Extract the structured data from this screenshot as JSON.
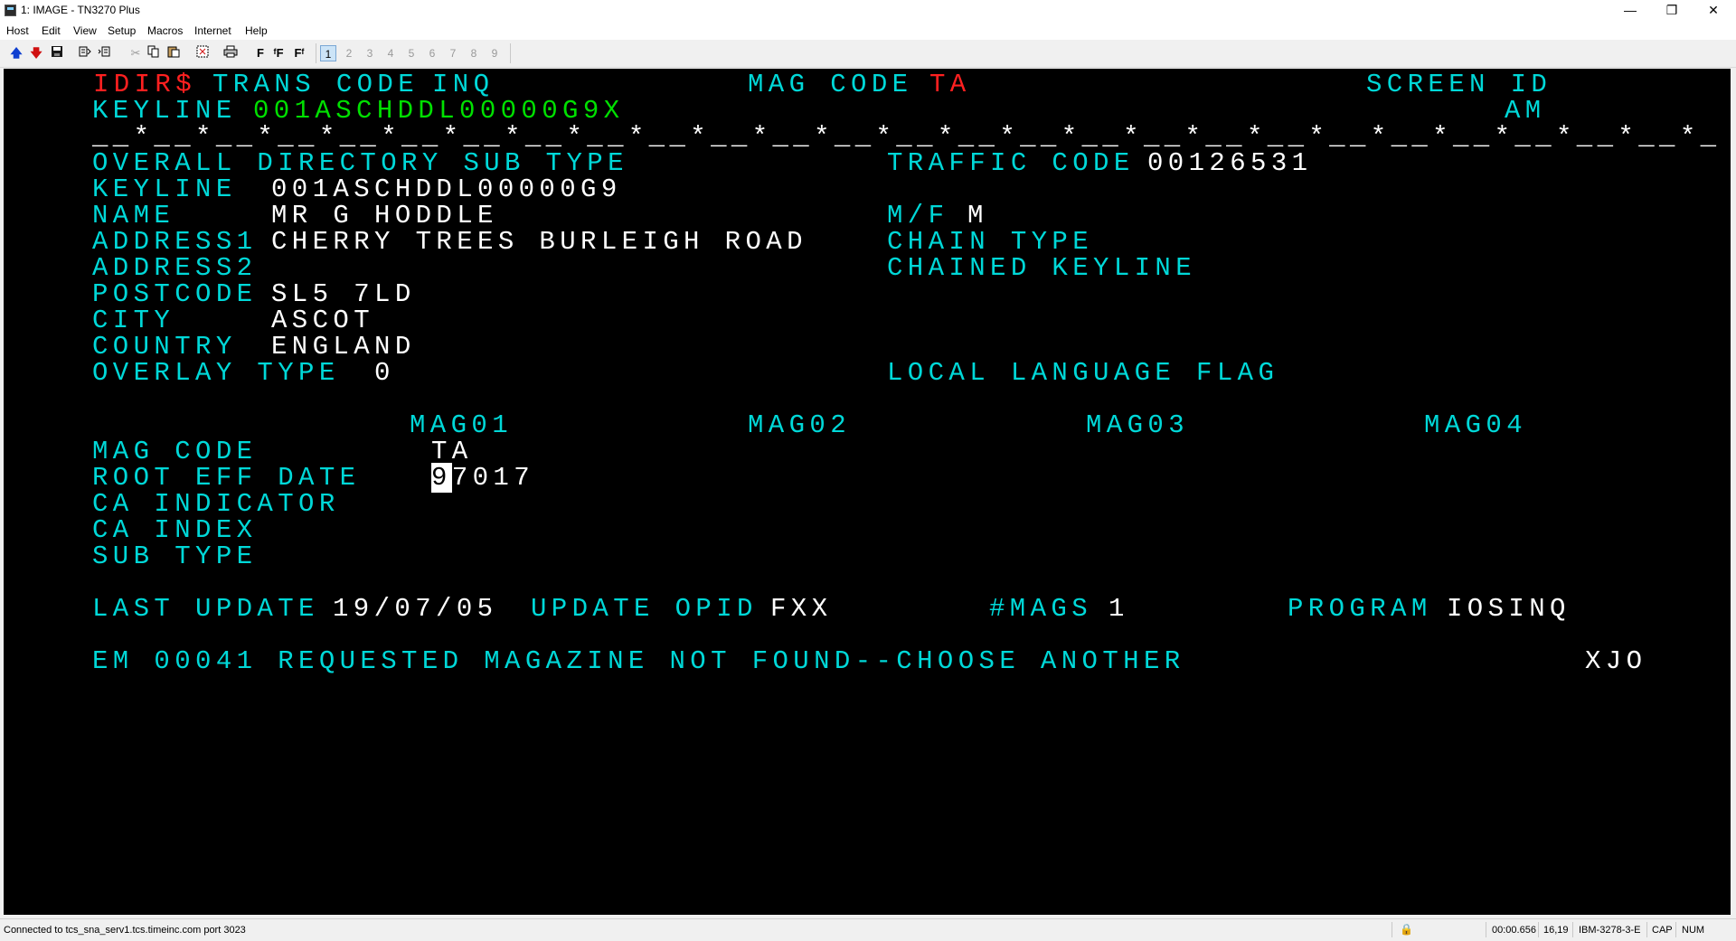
{
  "window": {
    "title": "1: IMAGE - TN3270 Plus",
    "minimize": "—",
    "restore": "❐",
    "close": "✕"
  },
  "menu": {
    "host": "Host",
    "edit": "Edit",
    "view": "View",
    "setup": "Setup",
    "macros": "Macros",
    "internet": "Internet",
    "help": "Help"
  },
  "toolbar": {
    "icons": [
      "arrow-up-icon",
      "arrow-down-icon",
      "save-icon",
      "copy-screen-icon",
      "paste-screen-icon",
      "cut-icon",
      "copy-icon",
      "paste-icon",
      "select-all-icon",
      "print-icon",
      "font-icon"
    ],
    "font1": "F",
    "font2": "ᶠF",
    "font3": "Fᶠ",
    "sessions": [
      "1",
      "2",
      "3",
      "4",
      "5",
      "6",
      "7",
      "8",
      "9"
    ]
  },
  "terminal": {
    "row1": {
      "idir": "IDIR$",
      "trans_code_label": "TRANS CODE",
      "inq": "INQ",
      "mag_code_label": "MAG CODE",
      "mag_code_value": "TA",
      "screen_id_label": "SCREEN ID"
    },
    "row2": {
      "keyline_label": "KEYLINE",
      "keyline_value": "001ASCHDDL00000G9X",
      "am": "AM"
    },
    "separator": "__*__*__*__*__*__*__*__*__*__*__*__*__*__*__*__*__*__*__*__*__*__*__*__*__*__*_",
    "overall_label": "OVERALL DIRECTORY SUB TYPE",
    "traffic_code_label": "TRAFFIC CODE",
    "traffic_code_value": "00126531",
    "keyline_label": "KEYLINE",
    "keyline_value": "001ASCHDDL00000G9",
    "name_label": "NAME",
    "name_value": "MR G HODDLE",
    "mf_label": "M/F",
    "mf_value": "M",
    "address1_label": "ADDRESS1",
    "address1_value": "CHERRY TREES BURLEIGH ROAD",
    "chain_type_label": "CHAIN TYPE",
    "address2_label": "ADDRESS2",
    "chained_keyline_label": "CHAINED KEYLINE",
    "postcode_label": "POSTCODE",
    "postcode_value": "SL5 7LD",
    "city_label": "CITY",
    "city_value": "ASCOT",
    "country_label": "COUNTRY",
    "country_value": "ENGLAND",
    "overlay_label": "OVERLAY TYPE",
    "overlay_value": "0",
    "local_language_label": "LOCAL LANGUAGE FLAG",
    "mag_headers": [
      "MAG01",
      "MAG02",
      "MAG03",
      "MAG04"
    ],
    "mag_code_label": "MAG CODE",
    "mag_code_value": "TA",
    "root_eff_date_label": "ROOT EFF DATE",
    "root_eff_date_cursor": "9",
    "root_eff_date_rest": "7017",
    "ca_indicator_label": "CA INDICATOR",
    "ca_index_label": "CA INDEX",
    "sub_type_label": "SUB TYPE",
    "last_update_label": "LAST UPDATE",
    "last_update_value": "19/07/05",
    "update_opid_label": "UPDATE OPID",
    "update_opid_value": "FXX",
    "mags_label": "#MAGS",
    "mags_value": "1",
    "program_label": "PROGRAM",
    "program_value": "IOSINQ",
    "message": "EM 00041 REQUESTED MAGAZINE NOT FOUND--CHOOSE ANOTHER",
    "message_code": "XJO"
  },
  "status": {
    "connection": "Connected to tcs_sna_serv1.tcs.timeinc.com port 3023",
    "lock": "🔒",
    "timer": "00:00.656",
    "cursor_pos": "16,19",
    "terminal_type": "IBM-3278-3-E",
    "cap": "CAP",
    "num": "NUM"
  }
}
